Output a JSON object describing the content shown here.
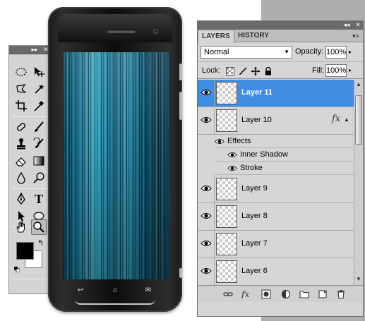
{
  "tools_panel": {
    "collapse_glyph": "▸▸",
    "close_glyph": "✕",
    "tools": [
      {
        "name": "marquee-tool-icon"
      },
      {
        "name": "move-tool-icon"
      },
      {
        "name": "lasso-tool-icon"
      },
      {
        "name": "magic-wand-tool-icon"
      },
      {
        "name": "crop-tool-icon"
      },
      {
        "name": "eyedropper-tool-icon"
      },
      {
        "name": "healing-brush-tool-icon"
      },
      {
        "name": "brush-tool-icon"
      },
      {
        "name": "clone-stamp-tool-icon"
      },
      {
        "name": "history-brush-tool-icon"
      },
      {
        "name": "eraser-tool-icon"
      },
      {
        "name": "gradient-tool-icon"
      },
      {
        "name": "blur-tool-icon"
      },
      {
        "name": "dodge-tool-icon"
      },
      {
        "name": "pen-tool-icon"
      },
      {
        "name": "type-tool-icon"
      },
      {
        "name": "path-selection-tool-icon"
      },
      {
        "name": "ellipse-shape-tool-icon"
      },
      {
        "name": "hand-tool-icon"
      },
      {
        "name": "zoom-tool-icon"
      }
    ],
    "type_tool_glyph": "T",
    "swap_glyph": "↰",
    "foreground_color": "#000000",
    "background_color": "#ffffff"
  },
  "phone": {
    "nav_back_glyph": "↩",
    "nav_home_glyph": "⌂",
    "nav_menu_glyph": "✉"
  },
  "layers_panel": {
    "collapse_glyph": "◂◂",
    "close_glyph": "✕",
    "tabs": [
      {
        "label": "LAYERS",
        "active": true
      },
      {
        "label": "HISTORY",
        "active": false
      }
    ],
    "menu_glyph": "▾≡",
    "blend_mode": "Normal",
    "opacity_label": "Opacity:",
    "opacity_value": "100%",
    "lock_label": "Lock:",
    "fill_label": "Fill:",
    "fill_value": "100%",
    "layers": [
      {
        "name": "Layer 11",
        "selected": true
      },
      {
        "name": "Layer 10",
        "selected": false,
        "fx": "fx"
      },
      {
        "name": "Layer 9",
        "selected": false
      },
      {
        "name": "Layer 8",
        "selected": false
      },
      {
        "name": "Layer 7",
        "selected": false
      },
      {
        "name": "Layer 6",
        "selected": false
      }
    ],
    "effects": {
      "header": "Effects",
      "items": [
        "Inner Shadow",
        "Stroke"
      ]
    },
    "selection_color": "#3f8ee3"
  }
}
